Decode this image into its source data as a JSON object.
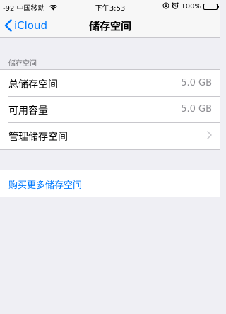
{
  "status_bar": {
    "signal": "-92",
    "carrier": "中国移动",
    "wifi_icon": "wifi-icon",
    "time": "下午3:53",
    "battery_percent": "100%",
    "icons": [
      "orientation-lock-icon",
      "alarm-icon",
      "battery-icon"
    ]
  },
  "nav": {
    "back_label": "iCloud",
    "title": "储存空间"
  },
  "storage_section": {
    "header": "储存空间",
    "rows": [
      {
        "label": "总储存空间",
        "value": "5.0 GB"
      },
      {
        "label": "可用容量",
        "value": "5.0 GB"
      },
      {
        "label": "管理储存空间",
        "value": ""
      }
    ]
  },
  "buy_section": {
    "link_label": "购买更多储存空间"
  },
  "colors": {
    "accent": "#007aff",
    "background": "#efeff4",
    "secondary_text": "#8e8e93",
    "separator": "#c8c7cc"
  }
}
